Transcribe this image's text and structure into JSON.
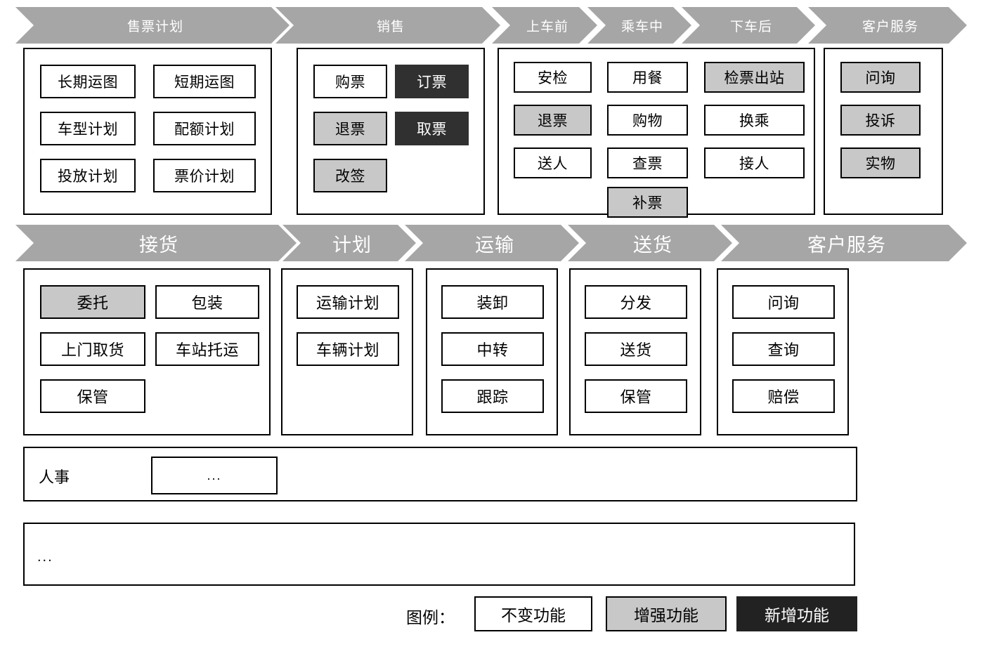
{
  "diagram": {
    "title": "Business Function Map",
    "colors": {
      "chevron_fill": "#a6a6a6",
      "chevron_text": "#ffffff",
      "unchanged_fill": "#ffffff",
      "enhanced_fill": "#c8c8c8",
      "new_fill": "#303030",
      "border": "#000000"
    }
  },
  "row1": {
    "stages": [
      {
        "label": "售票计划"
      },
      {
        "label": "销售"
      },
      {
        "label": "上车前"
      },
      {
        "label": "乘车中"
      },
      {
        "label": "下车后"
      },
      {
        "label": "客户服务"
      }
    ],
    "groups": [
      {
        "name": "ticket-plan-group",
        "columns": [
          [
            {
              "label": "长期运图",
              "state": "unchanged"
            },
            {
              "label": "车型计划",
              "state": "unchanged"
            },
            {
              "label": "投放计划",
              "state": "unchanged"
            }
          ],
          [
            {
              "label": "短期运图",
              "state": "unchanged"
            },
            {
              "label": "配额计划",
              "state": "unchanged"
            },
            {
              "label": "票价计划",
              "state": "unchanged"
            }
          ]
        ]
      },
      {
        "name": "sales-group",
        "columns": [
          [
            {
              "label": "购票",
              "state": "unchanged"
            },
            {
              "label": "退票",
              "state": "enhanced"
            },
            {
              "label": "改签",
              "state": "enhanced"
            }
          ],
          [
            {
              "label": "订票",
              "state": "new"
            },
            {
              "label": "取票",
              "state": "new"
            }
          ]
        ]
      },
      {
        "name": "journey-group",
        "columns": [
          [
            {
              "label": "安检",
              "state": "unchanged"
            },
            {
              "label": "退票",
              "state": "enhanced"
            },
            {
              "label": "送人",
              "state": "unchanged"
            }
          ],
          [
            {
              "label": "用餐",
              "state": "unchanged"
            },
            {
              "label": "购物",
              "state": "unchanged"
            },
            {
              "label": "查票",
              "state": "unchanged"
            },
            {
              "label": "补票",
              "state": "enhanced"
            }
          ],
          [
            {
              "label": "检票出站",
              "state": "enhanced"
            },
            {
              "label": "换乘",
              "state": "unchanged"
            },
            {
              "label": "接人",
              "state": "unchanged"
            }
          ]
        ]
      },
      {
        "name": "customer-service-group",
        "columns": [
          [
            {
              "label": "问询",
              "state": "enhanced"
            },
            {
              "label": "投诉",
              "state": "enhanced"
            },
            {
              "label": "实物",
              "state": "enhanced"
            }
          ]
        ]
      }
    ]
  },
  "row2": {
    "stages": [
      {
        "label": "接货"
      },
      {
        "label": "计划"
      },
      {
        "label": "运输"
      },
      {
        "label": "送货"
      },
      {
        "label": "客户服务"
      }
    ],
    "groups": [
      {
        "name": "pickup-group",
        "columns": [
          [
            {
              "label": "委托",
              "state": "enhanced"
            },
            {
              "label": "上门取货",
              "state": "unchanged"
            },
            {
              "label": "保管",
              "state": "unchanged"
            }
          ],
          [
            {
              "label": "包装",
              "state": "unchanged"
            },
            {
              "label": "车站托运",
              "state": "unchanged"
            }
          ]
        ]
      },
      {
        "name": "plan-group",
        "columns": [
          [
            {
              "label": "运输计划",
              "state": "unchanged"
            },
            {
              "label": "车辆计划",
              "state": "unchanged"
            }
          ]
        ]
      },
      {
        "name": "transport-group",
        "columns": [
          [
            {
              "label": "装卸",
              "state": "unchanged"
            },
            {
              "label": "中转",
              "state": "unchanged"
            },
            {
              "label": "跟踪",
              "state": "unchanged"
            }
          ]
        ]
      },
      {
        "name": "delivery-group",
        "columns": [
          [
            {
              "label": "分发",
              "state": "unchanged"
            },
            {
              "label": "送货",
              "state": "unchanged"
            },
            {
              "label": "保管",
              "state": "unchanged"
            }
          ]
        ]
      },
      {
        "name": "cargo-customer-service-group",
        "columns": [
          [
            {
              "label": "问询",
              "state": "unchanged"
            },
            {
              "label": "查询",
              "state": "unchanged"
            },
            {
              "label": "赔偿",
              "state": "unchanged"
            }
          ]
        ]
      }
    ]
  },
  "hr_row": {
    "label": "人事",
    "box_label": "..."
  },
  "more_row": {
    "label": "..."
  },
  "legend": {
    "title": "图例：",
    "items": [
      {
        "label": "不变功能",
        "state": "unchanged"
      },
      {
        "label": "增强功能",
        "state": "enhanced"
      },
      {
        "label": "新增功能",
        "state": "new"
      }
    ]
  }
}
